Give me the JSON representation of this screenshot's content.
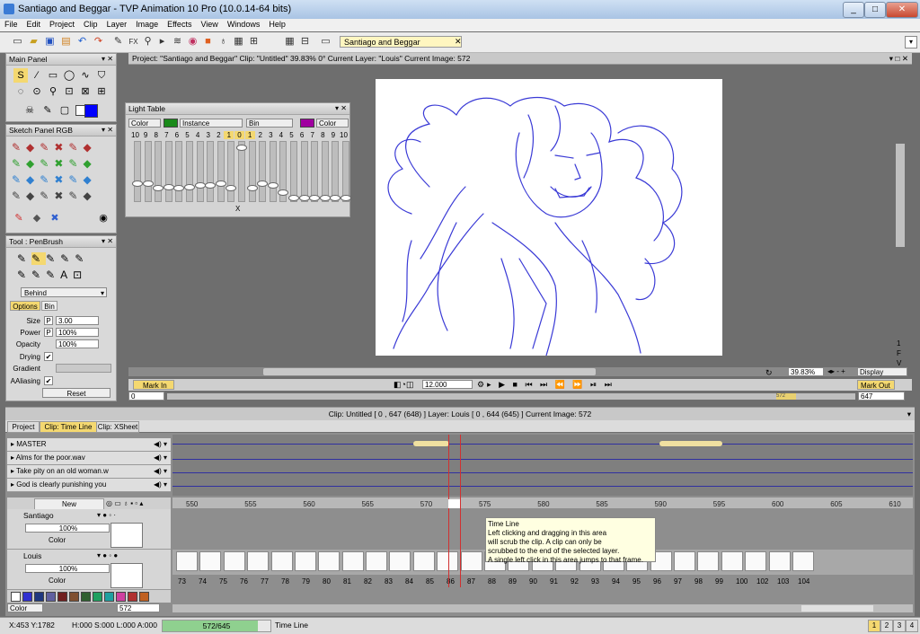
{
  "window": {
    "title": "Santiago and Beggar - TVP Animation 10 Pro (10.0.14-64 bits)"
  },
  "menu": [
    "File",
    "Edit",
    "Project",
    "Clip",
    "Layer",
    "Image",
    "Effects",
    "View",
    "Windows",
    "Help"
  ],
  "toolbar": {
    "clip_name": "Santiago and Beggar"
  },
  "project_bar": {
    "info": "Project: \"Santiago and Beggar\"  Clip: \"Untitled\"  39.83%  0°  Current Layer: \"Louis\"  Current Image: 572"
  },
  "main_panel": {
    "title": "Main Panel"
  },
  "sketch_panel": {
    "title": "Sketch Panel RGB"
  },
  "tool_panel": {
    "title": "Tool : PenBrush",
    "mode": "Behind",
    "tabs": [
      "Options",
      "Bin"
    ],
    "size_label": "Size",
    "size_value": "3.00",
    "power_label": "Power",
    "power_value": "100%",
    "opacity_label": "Opacity",
    "opacity_value": "100%",
    "drying_label": "Drying",
    "gradient_label": "Gradient",
    "aaliasing_label": "AAliasing",
    "reset_label": "Reset",
    "p_label": "P"
  },
  "light_table": {
    "title": "Light Table",
    "left_mode": "Color",
    "instance": "Instance",
    "bin": "Bin",
    "right_mode": "Color",
    "left_color": "#1a8a1a",
    "right_color": "#a000a0",
    "numbers_left": [
      "10",
      "9",
      "8",
      "7",
      "6",
      "5",
      "4",
      "3",
      "2",
      "1"
    ],
    "center": "0",
    "numbers_right": [
      "1",
      "2",
      "3",
      "4",
      "5",
      "6",
      "7",
      "8",
      "9",
      "10"
    ],
    "x_label": "X",
    "levels": [
      0.3,
      0.3,
      0.22,
      0.25,
      0.22,
      0.25,
      0.28,
      0.28,
      0.3,
      0.22,
      0.95,
      0.22,
      0.3,
      0.28,
      0.15,
      0.05,
      0.05,
      0.05,
      0.05,
      0.05,
      0.05
    ]
  },
  "playback": {
    "mark_in": "Mark In",
    "mark_out": "Mark Out",
    "fps": "12.000",
    "zoom": "39.83%",
    "display": "Display",
    "start": "0",
    "end": "647",
    "current": "572"
  },
  "timeline": {
    "clip_info": "Clip: Untitled [ 0 , 647  (648) ]      Layer: Louis [ 0 , 644  (645) ]      Current Image: 572",
    "tabs": [
      "Project",
      "Clip: Time Line",
      "Clip: XSheet"
    ],
    "sound_tracks": [
      "MASTER",
      "Alms for the poor.wav",
      "Take pity on an old woman.w",
      "God is clearly punishing you"
    ],
    "new_label": "New",
    "ruler": [
      "550",
      "555",
      "560",
      "565",
      "570",
      "575",
      "580",
      "585",
      "590",
      "595",
      "600",
      "605",
      "610"
    ],
    "layers": [
      {
        "name": "Santiago",
        "opacity": "100%",
        "mode": "Color"
      },
      {
        "name": "Louis",
        "opacity": "100%",
        "mode": "Color"
      }
    ],
    "frame_numbers": [
      "73",
      "74",
      "75",
      "76",
      "77",
      "78",
      "79",
      "80",
      "81",
      "82",
      "83",
      "84",
      "85",
      "86",
      "87",
      "88",
      "89",
      "90",
      "91",
      "92",
      "93",
      "94",
      "95",
      "96",
      "97",
      "98",
      "99",
      "100",
      "102",
      "103",
      "104"
    ],
    "tooltip": [
      "Time Line",
      "Left clicking and dragging in this area",
      "will scrub the clip. A clip can only be",
      "scrubbed to the end of the selected layer.",
      "A single left click in this area jumps to that frame."
    ],
    "colors": [
      "#ffffff",
      "#3030d0",
      "#203880",
      "#6060a0",
      "#702020",
      "#805030",
      "#306030",
      "#20a060",
      "#20a0a0",
      "#d040a0",
      "#b03030",
      "#c06020"
    ],
    "bottom_mode": "Color",
    "frame_field": "572"
  },
  "status": {
    "coords": "X:453  Y:1782",
    "hsl": "H:000 S:000 L:000 A:000",
    "progress": "572/645",
    "progress_fraction": 0.887,
    "section": "Time Line",
    "pages": [
      "1",
      "2",
      "3",
      "4"
    ]
  },
  "side_scroll": [
    "1",
    "F",
    "V"
  ]
}
